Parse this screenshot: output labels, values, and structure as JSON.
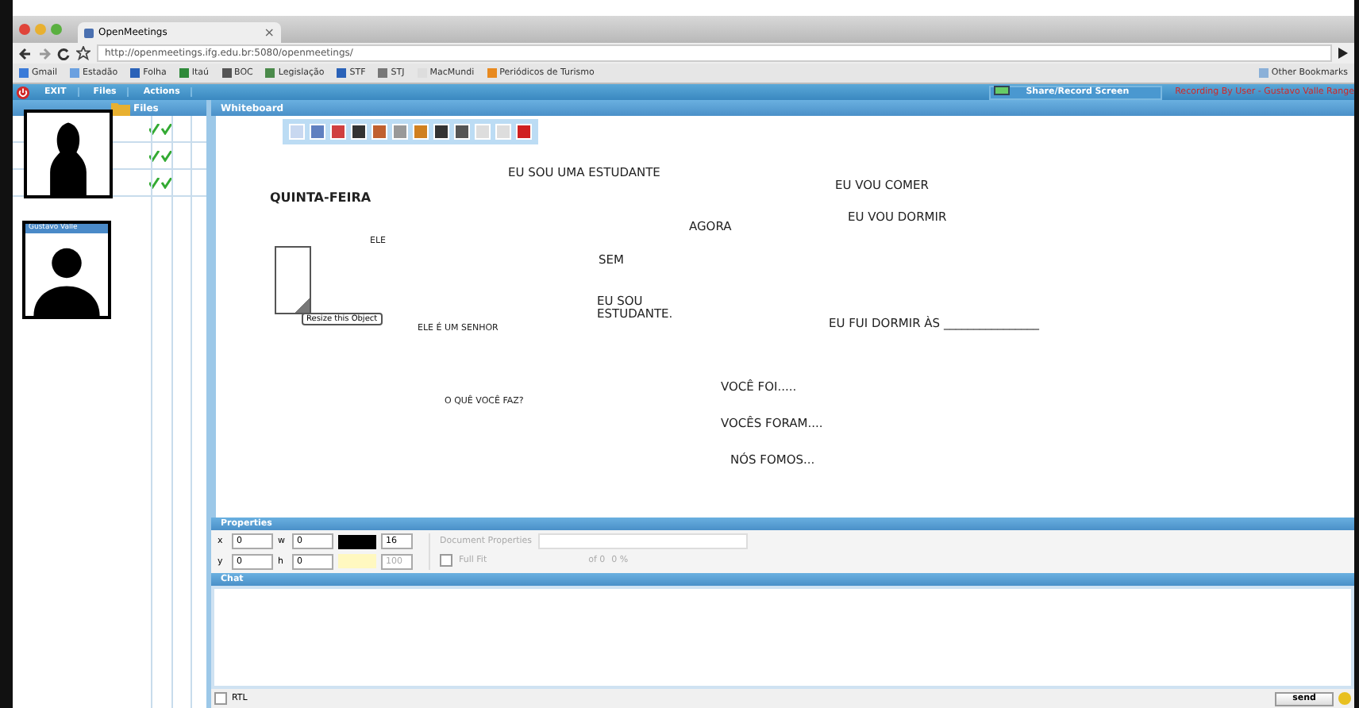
{
  "browser": {
    "tab_title": "OpenMeetings",
    "tab_close": "×",
    "url": "http://openmeetings.ifg.edu.br:5080/openmeetings/",
    "bookmarks": [
      "Gmail",
      "Estadão",
      "Folha",
      "Itaú",
      "BOC",
      "Legislação",
      "STF",
      "STJ",
      "MacMundi",
      "Periódicos de Turismo"
    ],
    "other_bookmarks": "Other Bookmarks"
  },
  "menu": [
    "EXIT",
    "Files",
    "Actions"
  ],
  "share_button": "Share/Record Screen",
  "recording_notice": "Recording By User - Gustavo Valle Range",
  "files_panel": {
    "title": "Files"
  },
  "video_windows": [
    {
      "kind": "picture"
    },
    {
      "kind": "picture",
      "title": "Gustavo Valle"
    }
  ],
  "whiteboard": {
    "title": "Whiteboard",
    "texts": [
      {
        "text": "EU SOU UMA ESTUDANTE",
        "kind": "normal"
      },
      {
        "text": "EU VOU COMER",
        "kind": "normal"
      },
      {
        "text": "QUINTA-FEIRA",
        "kind": "bold"
      },
      {
        "text": "EU VOU DORMIR",
        "kind": "normal"
      },
      {
        "text": "AGORA",
        "kind": "normal"
      },
      {
        "text": "ELE",
        "kind": "small"
      },
      {
        "text": "SEM",
        "kind": "normal"
      },
      {
        "text": "EU SOU\nESTUDANTE.",
        "kind": "normal"
      },
      {
        "text": "EU FUI DORMIR ÀS ________________",
        "kind": "normal"
      },
      {
        "text": "ELE É UM SENHOR",
        "kind": "small"
      },
      {
        "text": "VOCÊ FOI.....",
        "kind": "normal"
      },
      {
        "text": "O QUÊ VOCÊ FAZ?",
        "kind": "small"
      },
      {
        "text": "VOCÊS FORAM....",
        "kind": "normal"
      },
      {
        "text": "NÓS FOMOS...",
        "kind": "normal"
      }
    ],
    "tooltip": "Resize this Object"
  },
  "properties": {
    "title": "Properties",
    "fields": [
      {
        "label": "x",
        "value": "0"
      },
      {
        "label": "w",
        "value": "0"
      },
      {
        "label": "y",
        "value": "0"
      },
      {
        "label": "h",
        "value": "0"
      }
    ],
    "font_size": "16",
    "opacity": "100",
    "document_properties": "Document Properties",
    "full_fit": {
      "label": "Full Fit",
      "checked": false
    },
    "page_of": "of 0",
    "zoom": "0 %"
  },
  "chat": {
    "title": "Chat",
    "rtl": {
      "label": "RTL",
      "checked": false
    },
    "send": "send"
  }
}
